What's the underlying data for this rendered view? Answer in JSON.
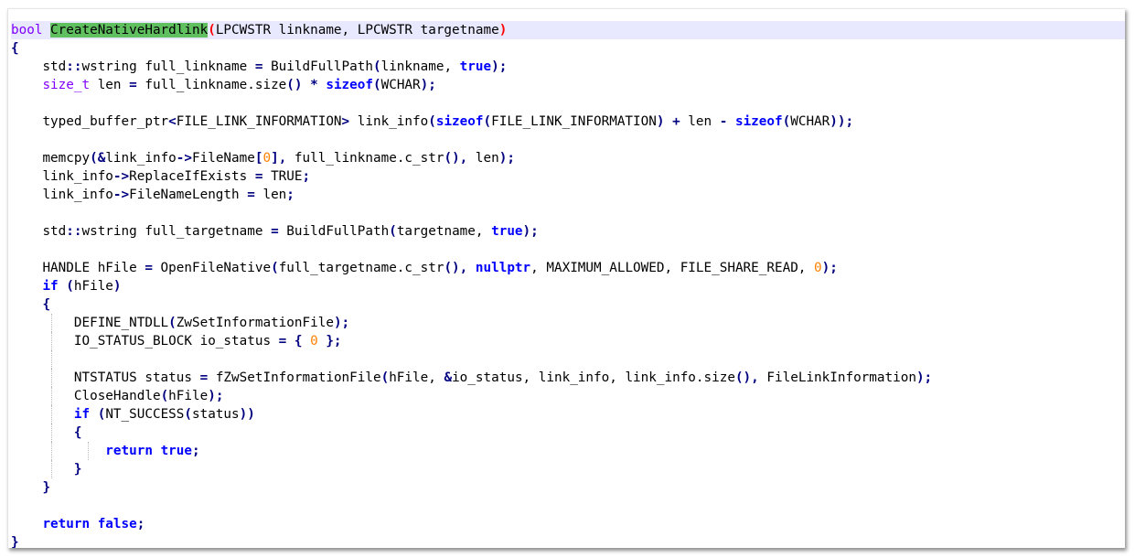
{
  "editor": {
    "language": "cpp",
    "current_line": 0,
    "colors": {
      "background": "#ffffff",
      "current_line": "#e8e8ff",
      "keyword": "#0000ff",
      "type": "#8000ff",
      "operator": "#000080",
      "number": "#ff8000",
      "brace_match": "#ff0000",
      "word_highlight": "#60c060",
      "indent_guide": "#b8b8b8"
    },
    "lines": [
      {
        "indent": 0,
        "tokens": [
          [
            "type",
            "bool"
          ],
          [
            "plain",
            " "
          ],
          [
            "hl",
            "CreateNativeHardlink"
          ],
          [
            "red",
            "("
          ],
          [
            "plain",
            "LPCWSTR linkname, LPCWSTR targetname"
          ],
          [
            "red",
            ")"
          ]
        ]
      },
      {
        "indent": 0,
        "tokens": [
          [
            "brace",
            "{"
          ]
        ]
      },
      {
        "indent": 1,
        "tokens": [
          [
            "plain",
            "std"
          ],
          [
            "op",
            "::"
          ],
          [
            "plain",
            "wstring full_linkname "
          ],
          [
            "op",
            "="
          ],
          [
            "plain",
            " BuildFullPath"
          ],
          [
            "op",
            "("
          ],
          [
            "plain",
            "linkname, "
          ],
          [
            "kw",
            "true"
          ],
          [
            "op",
            ");"
          ]
        ]
      },
      {
        "indent": 1,
        "tokens": [
          [
            "type",
            "size_t"
          ],
          [
            "plain",
            " len "
          ],
          [
            "op",
            "="
          ],
          [
            "plain",
            " full_linkname.size"
          ],
          [
            "op",
            "()"
          ],
          [
            "plain",
            " "
          ],
          [
            "op",
            "*"
          ],
          [
            "plain",
            " "
          ],
          [
            "kw",
            "sizeof"
          ],
          [
            "op",
            "("
          ],
          [
            "plain",
            "WCHAR"
          ],
          [
            "op",
            ");"
          ]
        ]
      },
      {
        "indent": 1,
        "tokens": []
      },
      {
        "indent": 1,
        "tokens": [
          [
            "plain",
            "typed_buffer_ptr"
          ],
          [
            "op",
            "<"
          ],
          [
            "plain",
            "FILE_LINK_INFORMATION"
          ],
          [
            "op",
            ">"
          ],
          [
            "plain",
            " link_info"
          ],
          [
            "op",
            "("
          ],
          [
            "kw",
            "sizeof"
          ],
          [
            "op",
            "("
          ],
          [
            "plain",
            "FILE_LINK_INFORMATION"
          ],
          [
            "op",
            ")"
          ],
          [
            "plain",
            " "
          ],
          [
            "op",
            "+"
          ],
          [
            "plain",
            " len "
          ],
          [
            "op",
            "-"
          ],
          [
            "plain",
            " "
          ],
          [
            "kw",
            "sizeof"
          ],
          [
            "op",
            "("
          ],
          [
            "plain",
            "WCHAR"
          ],
          [
            "op",
            "));"
          ]
        ]
      },
      {
        "indent": 1,
        "tokens": []
      },
      {
        "indent": 1,
        "tokens": [
          [
            "plain",
            "memcpy"
          ],
          [
            "op",
            "(&"
          ],
          [
            "plain",
            "link_info"
          ],
          [
            "op",
            "->"
          ],
          [
            "plain",
            "FileName"
          ],
          [
            "op",
            "["
          ],
          [
            "num",
            "0"
          ],
          [
            "op",
            "],"
          ],
          [
            "plain",
            " full_linkname.c_str"
          ],
          [
            "op",
            "(),"
          ],
          [
            "plain",
            " len"
          ],
          [
            "op",
            ");"
          ]
        ]
      },
      {
        "indent": 1,
        "tokens": [
          [
            "plain",
            "link_info"
          ],
          [
            "op",
            "->"
          ],
          [
            "plain",
            "ReplaceIfExists "
          ],
          [
            "op",
            "="
          ],
          [
            "plain",
            " TRUE"
          ],
          [
            "op",
            ";"
          ]
        ]
      },
      {
        "indent": 1,
        "tokens": [
          [
            "plain",
            "link_info"
          ],
          [
            "op",
            "->"
          ],
          [
            "plain",
            "FileNameLength "
          ],
          [
            "op",
            "="
          ],
          [
            "plain",
            " len"
          ],
          [
            "op",
            ";"
          ]
        ]
      },
      {
        "indent": 1,
        "tokens": []
      },
      {
        "indent": 1,
        "tokens": [
          [
            "plain",
            "std"
          ],
          [
            "op",
            "::"
          ],
          [
            "plain",
            "wstring full_targetname "
          ],
          [
            "op",
            "="
          ],
          [
            "plain",
            " BuildFullPath"
          ],
          [
            "op",
            "("
          ],
          [
            "plain",
            "targetname, "
          ],
          [
            "kw",
            "true"
          ],
          [
            "op",
            ");"
          ]
        ]
      },
      {
        "indent": 1,
        "tokens": []
      },
      {
        "indent": 1,
        "tokens": [
          [
            "plain",
            "HANDLE hFile "
          ],
          [
            "op",
            "="
          ],
          [
            "plain",
            " OpenFileNative"
          ],
          [
            "op",
            "("
          ],
          [
            "plain",
            "full_targetname.c_str"
          ],
          [
            "op",
            "(),"
          ],
          [
            "plain",
            " "
          ],
          [
            "kw",
            "nullptr"
          ],
          [
            "plain",
            ", MAXIMUM_ALLOWED, FILE_SHARE_READ, "
          ],
          [
            "num",
            "0"
          ],
          [
            "op",
            ");"
          ]
        ]
      },
      {
        "indent": 1,
        "tokens": [
          [
            "kw",
            "if"
          ],
          [
            "plain",
            " "
          ],
          [
            "op",
            "("
          ],
          [
            "plain",
            "hFile"
          ],
          [
            "op",
            ")"
          ]
        ]
      },
      {
        "indent": 1,
        "tokens": [
          [
            "brace",
            "{"
          ]
        ]
      },
      {
        "indent": 2,
        "tokens": [
          [
            "plain",
            "DEFINE_NTDLL"
          ],
          [
            "op",
            "("
          ],
          [
            "plain",
            "ZwSetInformationFile"
          ],
          [
            "op",
            ");"
          ]
        ]
      },
      {
        "indent": 2,
        "tokens": [
          [
            "plain",
            "IO_STATUS_BLOCK io_status "
          ],
          [
            "op",
            "="
          ],
          [
            "plain",
            " "
          ],
          [
            "op",
            "{"
          ],
          [
            "plain",
            " "
          ],
          [
            "num",
            "0"
          ],
          [
            "plain",
            " "
          ],
          [
            "op",
            "};"
          ]
        ]
      },
      {
        "indent": 2,
        "tokens": []
      },
      {
        "indent": 2,
        "tokens": [
          [
            "plain",
            "NTSTATUS status "
          ],
          [
            "op",
            "="
          ],
          [
            "plain",
            " fZwSetInformationFile"
          ],
          [
            "op",
            "("
          ],
          [
            "plain",
            "hFile, "
          ],
          [
            "op",
            "&"
          ],
          [
            "plain",
            "io_status, link_info, link_info.size"
          ],
          [
            "op",
            "(),"
          ],
          [
            "plain",
            " FileLinkInformation"
          ],
          [
            "op",
            ");"
          ]
        ]
      },
      {
        "indent": 2,
        "tokens": [
          [
            "plain",
            "CloseHandle"
          ],
          [
            "op",
            "("
          ],
          [
            "plain",
            "hFile"
          ],
          [
            "op",
            ");"
          ]
        ]
      },
      {
        "indent": 2,
        "tokens": [
          [
            "kw",
            "if"
          ],
          [
            "plain",
            " "
          ],
          [
            "op",
            "("
          ],
          [
            "plain",
            "NT_SUCCESS"
          ],
          [
            "op",
            "("
          ],
          [
            "plain",
            "status"
          ],
          [
            "op",
            "))"
          ]
        ]
      },
      {
        "indent": 2,
        "tokens": [
          [
            "brace",
            "{"
          ]
        ]
      },
      {
        "indent": 3,
        "tokens": [
          [
            "kw",
            "return"
          ],
          [
            "plain",
            " "
          ],
          [
            "kw",
            "true"
          ],
          [
            "op",
            ";"
          ]
        ]
      },
      {
        "indent": 2,
        "tokens": [
          [
            "brace",
            "}"
          ]
        ]
      },
      {
        "indent": 1,
        "tokens": [
          [
            "brace",
            "}"
          ]
        ]
      },
      {
        "indent": 1,
        "tokens": []
      },
      {
        "indent": 1,
        "tokens": [
          [
            "kw",
            "return"
          ],
          [
            "plain",
            " "
          ],
          [
            "kw",
            "false"
          ],
          [
            "op",
            ";"
          ]
        ]
      },
      {
        "indent": 0,
        "tokens": [
          [
            "brace",
            "}"
          ]
        ]
      }
    ]
  }
}
